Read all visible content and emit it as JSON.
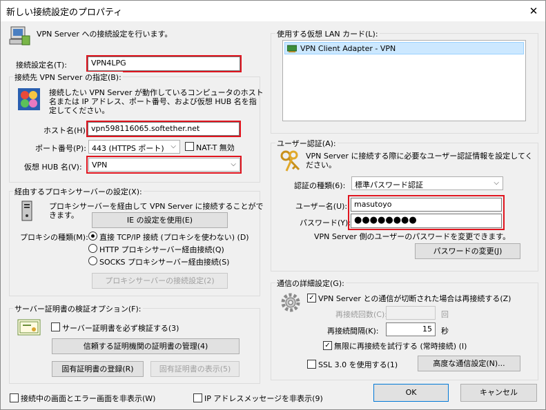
{
  "window": {
    "title": "新しい接続設定のプロパティ",
    "close_glyph": "✕"
  },
  "intro": {
    "text": "VPN Server への接続設定を行います。"
  },
  "connection_name": {
    "label": "接続設定名(T):",
    "value": "VPN4LPG"
  },
  "destination": {
    "group_title": "接続先 VPN Server の指定(B):",
    "description_line1": "接続したい VPN Server が動作しているコンピュータのホスト",
    "description_line2": "名または IP アドレス、ポート番号、および仮想 HUB 名を指",
    "description_line3": "定してください。",
    "host_label": "ホスト名(H):",
    "host_value": "vpn598116065.softether.net",
    "port_label": "ポート番号(P):",
    "port_value": "443 (HTTPS ポート)",
    "natt_label": "NAT-T 無効",
    "hub_label": "仮想 HUB 名(V):",
    "hub_value": "VPN"
  },
  "proxy": {
    "group_title": "経由するプロキシサーバーの設定(X):",
    "description_line1": "プロキシサーバーを経由して VPN Server に接続することがで",
    "description_line2": "きます。",
    "ie_button": "IE の設定を使用(E)",
    "type_label": "プロキシの種類(M):",
    "option_direct": "直接 TCP/IP 接続 (プロキシを使わない) (D)",
    "option_http": "HTTP プロキシサーバー経由接続(Q)",
    "option_socks": "SOCKS プロキシサーバー経由接続(S)",
    "settings_button": "プロキシサーバーの接続設定(2)"
  },
  "cert": {
    "group_title": "サーバー証明書の検証オプション(F):",
    "verify_label": "サーバー証明書を必ず検証する(3)",
    "manage_button": "信頼する証明機関の証明書の管理(4)",
    "register_button": "固有証明書の登録(R)",
    "show_button": "固有証明書の表示(5)"
  },
  "lan_card": {
    "group_title": "使用する仮想 LAN カード(L):",
    "items": [
      "VPN Client Adapter - VPN"
    ]
  },
  "auth": {
    "group_title": "ユーザー認証(A):",
    "description_line1": "VPN Server に接続する際に必要なユーザー認証情報を設定してく",
    "description_line2": "ださい。",
    "type_label": "認証の種類(6):",
    "type_value": "標準パスワード認証",
    "user_label": "ユーザー名(U):",
    "user_value": "masutoyo",
    "password_label": "パスワード(Y):",
    "password_value": "●●●●●●●●",
    "note": "VPN Server 側のユーザーのパスワードを変更できます。",
    "change_button": "パスワードの変更(J)"
  },
  "advanced": {
    "group_title": "通信の詳細設定(G):",
    "reconnect_label": "VPN Server との通信が切断された場合は再接続する(Z)",
    "retry_count_label": "再接続回数(C):",
    "retry_count_unit": "回",
    "interval_label": "再接続間隔(K):",
    "interval_value": "15",
    "interval_unit": "秒",
    "infinite_label": "無限に再接続を試行する (常時接続) (I)",
    "ssl3_label": "SSL 3.0 を使用する(1)",
    "advanced_button": "高度な通信設定(N)..."
  },
  "footer": {
    "hide_status_label": "接続中の画面とエラー画面を非表示(W)",
    "hide_ip_label": "IP アドレスメッセージを非表示(9)",
    "ok_button": "OK",
    "cancel_button": "キャンセル"
  }
}
